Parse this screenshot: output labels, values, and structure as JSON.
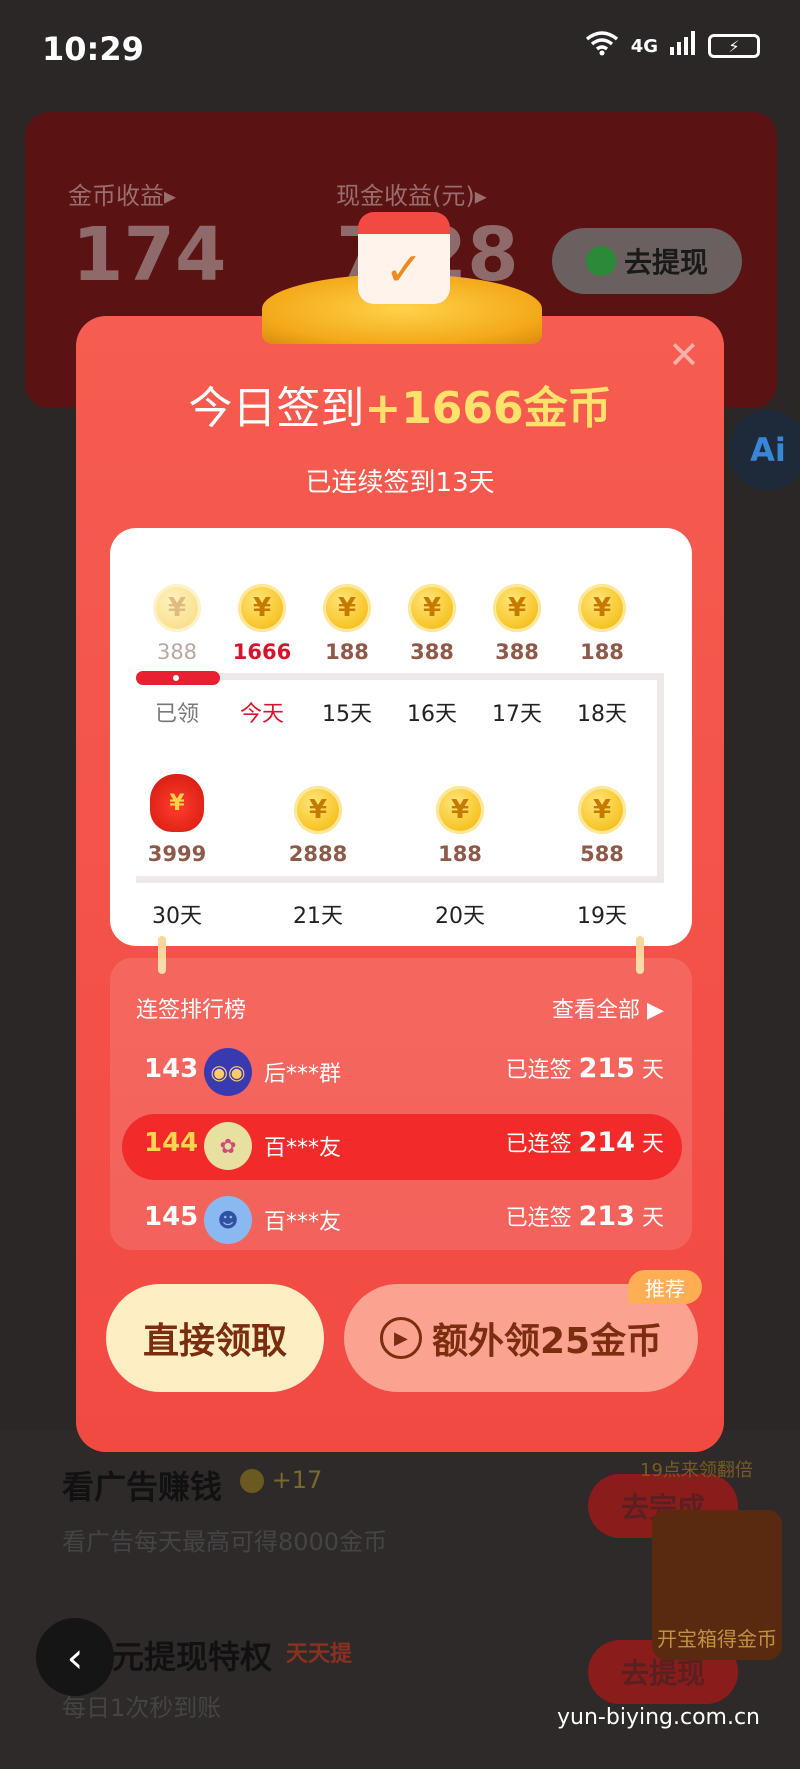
{
  "status_bar": {
    "time": "10:29",
    "wifi_icon": "wifi-icon",
    "signal": "4G",
    "battery_icon": "battery-charging-icon"
  },
  "background": {
    "gold_label": "金币收益▸",
    "gold_value": "174",
    "cash_label": "现金收益(元)▸",
    "cash_value": "7.28",
    "withdraw_button": "去提现",
    "ai_badge": "Ai",
    "task_ad_title": "看广告赚钱",
    "task_ad_reward": "+17",
    "task_ad_sub": "看广告每天最高可得8000金币",
    "task_ad_button": "去完成",
    "task_ad_tag": "19点来领翻倍",
    "task_withdraw_title": "元提现特权",
    "task_withdraw_tag": "天天提",
    "task_withdraw_sub": "每日1次秒到账",
    "task_withdraw_button": "去提现",
    "side_badge": "开宝箱得金币",
    "watermark": "yun-biying.com.cn"
  },
  "modal": {
    "close_icon": "close-icon",
    "title_prefix": "今日签到",
    "title_amount": "+1666金币",
    "subtitle": "已连续签到13天",
    "row1": [
      {
        "amount": "388",
        "day": "已领",
        "state": "done"
      },
      {
        "amount": "1666",
        "day": "今天",
        "state": "today"
      },
      {
        "amount": "188",
        "day": "15天",
        "state": "future"
      },
      {
        "amount": "388",
        "day": "16天",
        "state": "future"
      },
      {
        "amount": "388",
        "day": "17天",
        "state": "future"
      },
      {
        "amount": "188",
        "day": "18天",
        "state": "future"
      }
    ],
    "row2": [
      {
        "amount": "3999",
        "day": "30天",
        "icon": "red-envelope-icon"
      },
      {
        "amount": "2888",
        "day": "21天"
      },
      {
        "amount": "188",
        "day": "20天"
      },
      {
        "amount": "588",
        "day": "19天"
      }
    ],
    "ranking": {
      "title": "连签排行榜",
      "view_all": "查看全部 ▶",
      "rows": [
        {
          "rank": "143",
          "name": "后***群",
          "prefix": "已连签",
          "days": "215",
          "unit": "天",
          "avatar": "owl-avatar-icon"
        },
        {
          "rank": "144",
          "name": "百***友",
          "prefix": "已连签",
          "days": "214",
          "unit": "天",
          "avatar": "lotus-avatar-icon"
        },
        {
          "rank": "145",
          "name": "百***友",
          "prefix": "已连签",
          "days": "213",
          "unit": "天",
          "avatar": "cartoon-avatar-icon"
        }
      ]
    },
    "direct_button": "直接领取",
    "extra_button": "额外领25金币",
    "recommend_badge": "推荐"
  },
  "colors": {
    "modal_red": "#f14a43",
    "gold": "#ffe26c",
    "today_red": "#d7142c"
  }
}
